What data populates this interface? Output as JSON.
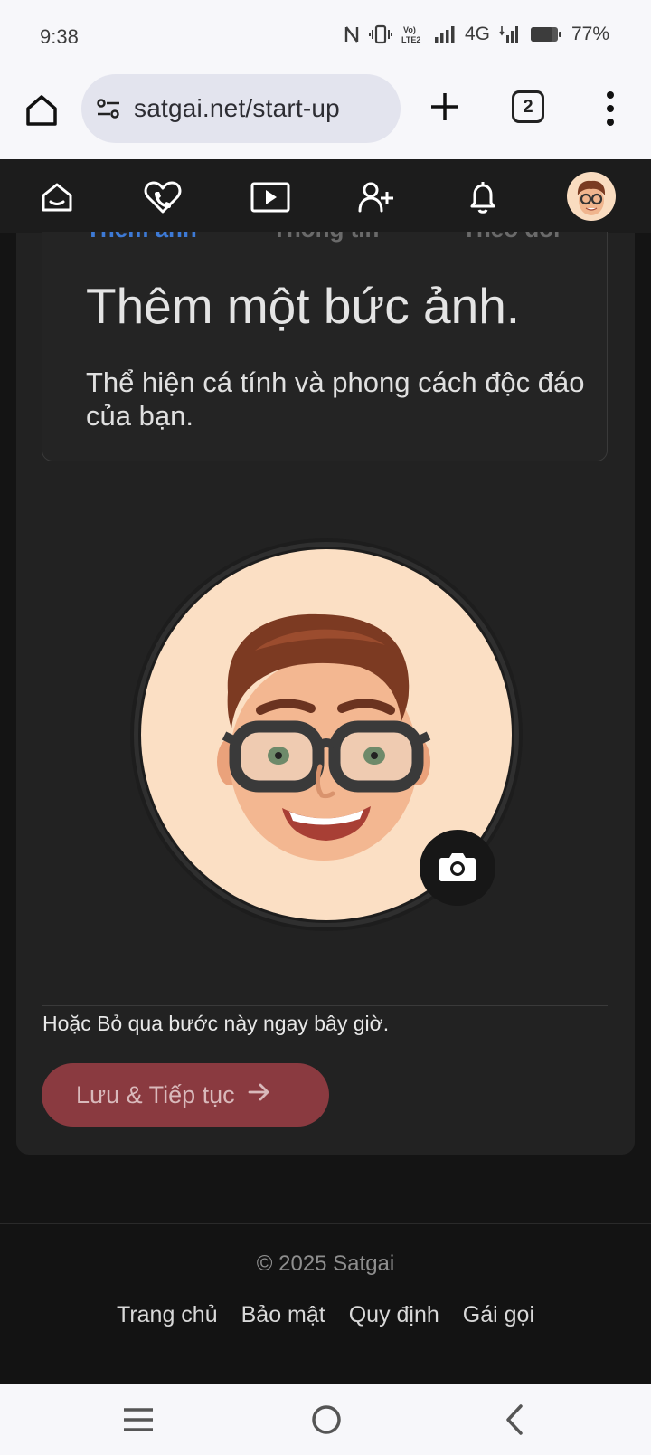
{
  "status_bar": {
    "time": "9:38",
    "network": "4G",
    "volte": "Vo) LTE2",
    "battery": "77%"
  },
  "browser": {
    "url": "satgai.net/start-up",
    "tab_count": "2"
  },
  "site_nav": {
    "items": [
      "home-icon",
      "heart-call-icon",
      "video-play-icon",
      "add-user-icon",
      "bell-icon"
    ],
    "avatar": "user-avatar"
  },
  "step_tabs": [
    "Thêm ảnh",
    "Thông tin",
    "Theo dõi"
  ],
  "main": {
    "title": "Thêm một bức ảnh.",
    "subtitle": "Thể hiện cá tính và phong cách độc đáo của bạn.",
    "skip_text": "Hoặc Bỏ qua bước này ngay bây giờ.",
    "save_label": "Lưu & Tiếp tục"
  },
  "footer": {
    "copyright": "© 2025 Satgai",
    "links": [
      "Trang chủ",
      "Bảo mật",
      "Quy định",
      "Gái gọi"
    ]
  },
  "colors": {
    "accent_tab": "#3d7ad6",
    "save_button": "#8a3a40",
    "card_bg": "#222222",
    "avatar_bg": "#fbdfc4"
  }
}
